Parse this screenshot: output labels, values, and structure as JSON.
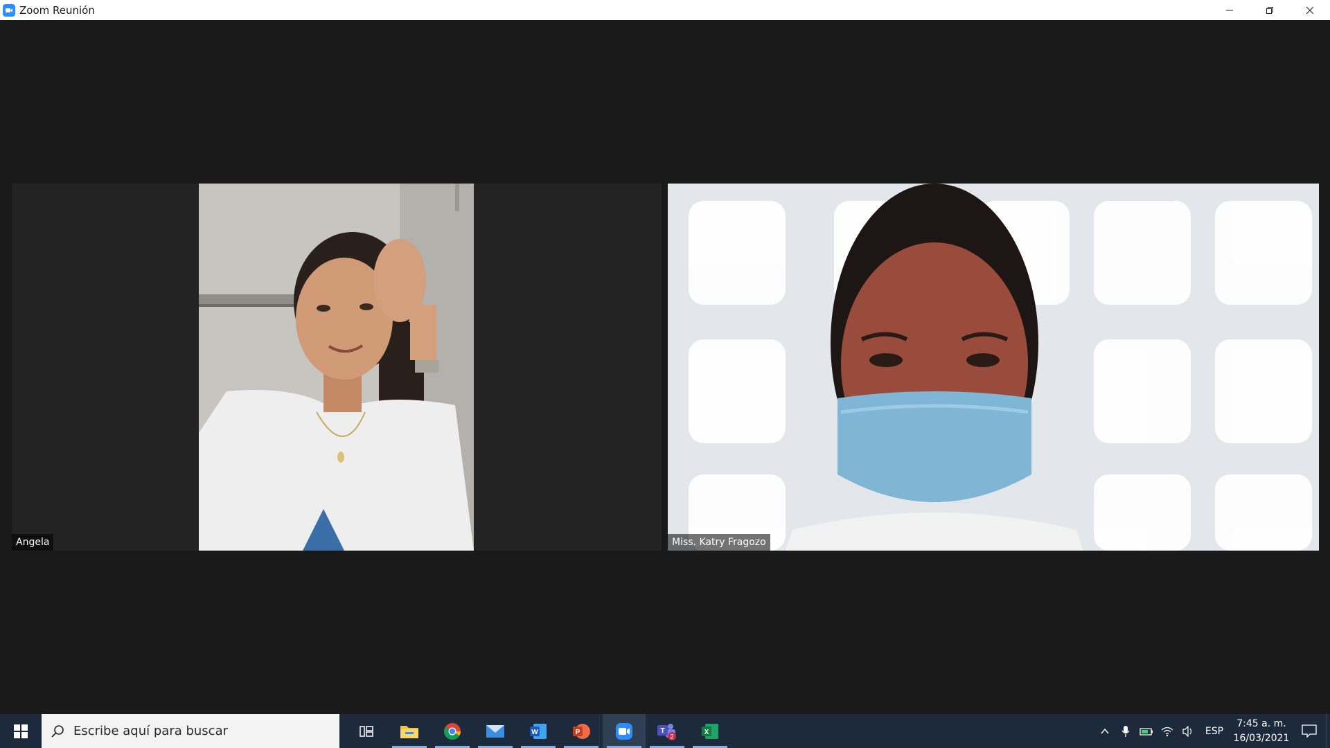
{
  "window": {
    "title": "Zoom Reunión",
    "controls": [
      "minimize-icon",
      "restore-icon",
      "close-icon"
    ]
  },
  "participants": [
    {
      "name": "Angela"
    },
    {
      "name": "Miss. Katry Fragozo"
    }
  ],
  "taskbar": {
    "search_placeholder": "Escribe aquí para buscar",
    "apps": [
      {
        "icon": "task-view-icon",
        "running": false
      },
      {
        "icon": "file-explorer-icon",
        "running": true
      },
      {
        "icon": "chrome-icon",
        "running": true
      },
      {
        "icon": "mail-icon",
        "running": true
      },
      {
        "icon": "word-icon",
        "running": true
      },
      {
        "icon": "powerpoint-icon",
        "running": true
      },
      {
        "icon": "zoom-icon",
        "running": true,
        "active": true
      },
      {
        "icon": "teams-icon",
        "running": true,
        "badge": "2"
      },
      {
        "icon": "excel-icon",
        "running": true
      }
    ],
    "tray": {
      "icons": [
        "chevron-up-icon",
        "microphone-icon",
        "battery-icon",
        "wifi-icon",
        "volume-icon"
      ],
      "language": "ESP",
      "time": "7:45 a. m.",
      "date": "16/03/2021"
    }
  },
  "colors": {
    "zoom_blue": "#2d8cff",
    "taskbar": "#1c2a3b",
    "meeting_bg": "#1a1a1a"
  }
}
